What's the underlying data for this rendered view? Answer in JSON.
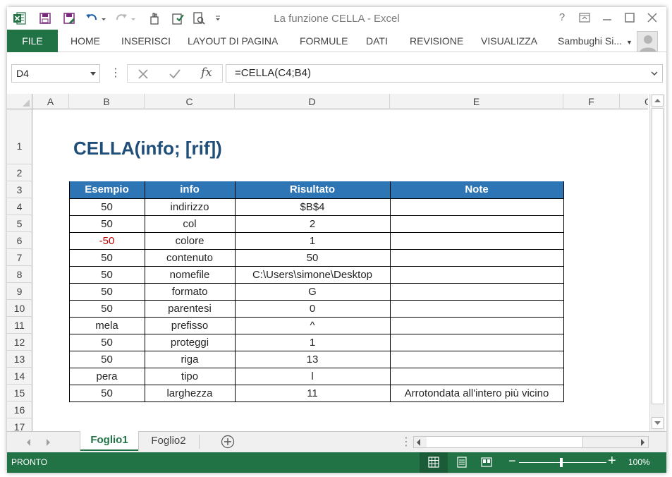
{
  "window": {
    "title": "La funzione CELLA - Excel",
    "help": "?"
  },
  "ribbon": {
    "file": "FILE",
    "tabs": [
      "HOME",
      "INSERISCI",
      "LAYOUT DI PAGINA",
      "FORMULE",
      "DATI",
      "REVISIONE",
      "VISUALIZZA"
    ],
    "user": "Sambughi Si..."
  },
  "formula_bar": {
    "name_box": "D4",
    "formula": "=CELLA(C4;B4)",
    "fx": "fx"
  },
  "grid": {
    "columns": [
      "A",
      "B",
      "C",
      "D",
      "E",
      "F",
      "G"
    ],
    "rows": [
      "1",
      "2",
      "3",
      "4",
      "5",
      "6",
      "7",
      "8",
      "9",
      "10",
      "11",
      "12",
      "13",
      "14",
      "15",
      "16",
      "17"
    ],
    "title": "CELLA(info; [rif])",
    "table_headers": [
      "Esempio",
      "info",
      "Risultato",
      "Note"
    ],
    "table_rows": [
      [
        "50",
        "indirizzo",
        "$B$4",
        ""
      ],
      [
        "50",
        "col",
        "2",
        ""
      ],
      [
        "-50",
        "colore",
        "1",
        ""
      ],
      [
        "50",
        "contenuto",
        "50",
        ""
      ],
      [
        "50",
        "nomefile",
        "C:\\Users\\simone\\Desktop",
        ""
      ],
      [
        "50",
        "formato",
        "G",
        ""
      ],
      [
        "50",
        "parentesi",
        "0",
        ""
      ],
      [
        "mela",
        "prefisso",
        "^",
        ""
      ],
      [
        "50",
        "proteggi",
        "1",
        ""
      ],
      [
        "50",
        "riga",
        "13",
        ""
      ],
      [
        "pera",
        "tipo",
        "l",
        ""
      ],
      [
        "50",
        "larghezza",
        "11",
        "Arrotondata all'intero più vicino"
      ]
    ],
    "negative_color": "#c00000",
    "header_color": "#2e75b6",
    "title_color": "#1f4e79"
  },
  "sheets": {
    "active": "Foglio1",
    "other": "Foglio2"
  },
  "status": {
    "ready": "PRONTO",
    "zoom": "100%",
    "minus": "−",
    "plus": "+"
  },
  "accent": "#217346"
}
